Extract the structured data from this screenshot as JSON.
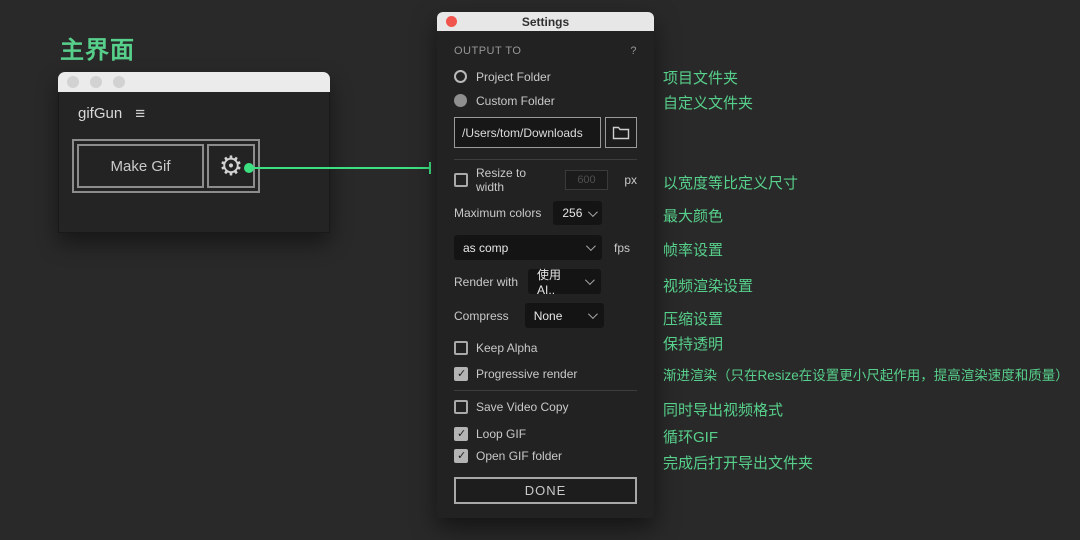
{
  "page": {
    "heading": "主界面"
  },
  "colors": {
    "accent_green": "#57d08b",
    "connector_green": "#3ce081",
    "titlebar_red": "#f0544c"
  },
  "gifgun_window": {
    "title": "gifGun",
    "menu_icon": "hamburger-icon",
    "make_gif_label": "Make Gif",
    "settings_icon": "gear-icon"
  },
  "settings_panel": {
    "window_title": "Settings",
    "output_to_label": "OUTPUT TO",
    "help_label": "?",
    "project_folder": {
      "label": "Project Folder",
      "selected": false
    },
    "custom_folder": {
      "label": "Custom Folder",
      "selected": true
    },
    "path_value": "/Users/tom/Downloads",
    "resize": {
      "label": "Resize to width",
      "checked": false,
      "value": "600",
      "unit": "px"
    },
    "max_colors": {
      "label": "Maximum colors",
      "value": "256"
    },
    "frame_rate": {
      "value": "as comp",
      "unit": "fps"
    },
    "render_with": {
      "label": "Render with",
      "value": "使用 AI.."
    },
    "compress": {
      "label": "Compress",
      "value": "None"
    },
    "keep_alpha": {
      "label": "Keep Alpha",
      "checked": false
    },
    "progressive_render": {
      "label": "Progressive render",
      "checked": true
    },
    "save_video_copy": {
      "label": "Save Video Copy",
      "checked": false
    },
    "loop_gif": {
      "label": "Loop GIF",
      "checked": true
    },
    "open_gif_folder": {
      "label": "Open GIF folder",
      "checked": true
    },
    "done_label": "DONE"
  },
  "annotations": [
    {
      "text": "项目文件夹"
    },
    {
      "text": "自定义文件夹"
    },
    {
      "text": "以宽度等比定义尺寸"
    },
    {
      "text": "最大颜色"
    },
    {
      "text": "帧率设置"
    },
    {
      "text": "视频渲染设置"
    },
    {
      "text": "压缩设置"
    },
    {
      "text": "保持透明"
    },
    {
      "text": "渐进渲染（只在Resize在设置更小尺起作用，提高渲染速度和质量）"
    },
    {
      "text": "同时导出视频格式"
    },
    {
      "text": "循环GIF"
    },
    {
      "text": "完成后打开导出文件夹"
    }
  ]
}
